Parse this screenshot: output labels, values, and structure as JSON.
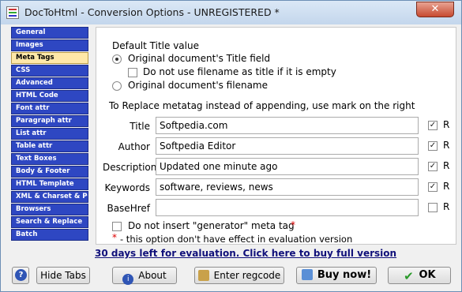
{
  "window": {
    "title": "DocToHtml - Conversion Options - UNREGISTERED *",
    "close_glyph": "✕"
  },
  "nav": {
    "items": [
      {
        "label": "General"
      },
      {
        "label": "Images"
      },
      {
        "label": "Meta Tags",
        "active": true
      },
      {
        "label": "CSS"
      },
      {
        "label": "Advanced"
      },
      {
        "label": "HTML Code"
      },
      {
        "label": "Font attr"
      },
      {
        "label": "Paragraph attr"
      },
      {
        "label": "List attr"
      },
      {
        "label": "Table attr"
      },
      {
        "label": "Text Boxes"
      },
      {
        "label": "Body & Footer"
      },
      {
        "label": "HTML Template"
      },
      {
        "label": "XML & Charset & PG"
      },
      {
        "label": "Browsers"
      },
      {
        "label": "Search & Replace"
      },
      {
        "label": "Batch"
      }
    ]
  },
  "default_title": {
    "group_label": "Default Title value",
    "opt_original_title": "Original document's Title field",
    "opt_no_filename": "Do not use filename as title if it is empty",
    "opt_filename": "Original document's filename",
    "selected": "original_title"
  },
  "replace_note": "To Replace metatag instead of appending, use mark on the right",
  "fields": {
    "title": {
      "label": "Title",
      "value": "Softpedia.com",
      "replace": true
    },
    "author": {
      "label": "Author",
      "value": "Softpedia Editor",
      "replace": true
    },
    "description": {
      "label": "Description",
      "value": "Updated one minute ago",
      "replace": true
    },
    "keywords": {
      "label": "Keywords",
      "value": "software, reviews, news",
      "replace": true
    },
    "basehref": {
      "label": "BaseHref",
      "value": "",
      "replace": false
    },
    "r_label": "R"
  },
  "generator": {
    "label": "Do not insert \"generator\" meta tag",
    "star": "*",
    "note_star": "*",
    "note": " - this option don't have effect in evaluation version"
  },
  "eval_link": "30 days left for evaluation. Click here to buy full version",
  "buttons": {
    "help": "?",
    "hide_tabs": "Hide Tabs",
    "about": "About",
    "enter_regcode": "Enter regcode",
    "buy_now": "Buy now!",
    "ok": "OK"
  },
  "colors": {
    "nav_bg": "#2e47c2",
    "nav_active_bg": "#ffe8a8",
    "link": "#10107a",
    "required_star": "#d00000"
  }
}
